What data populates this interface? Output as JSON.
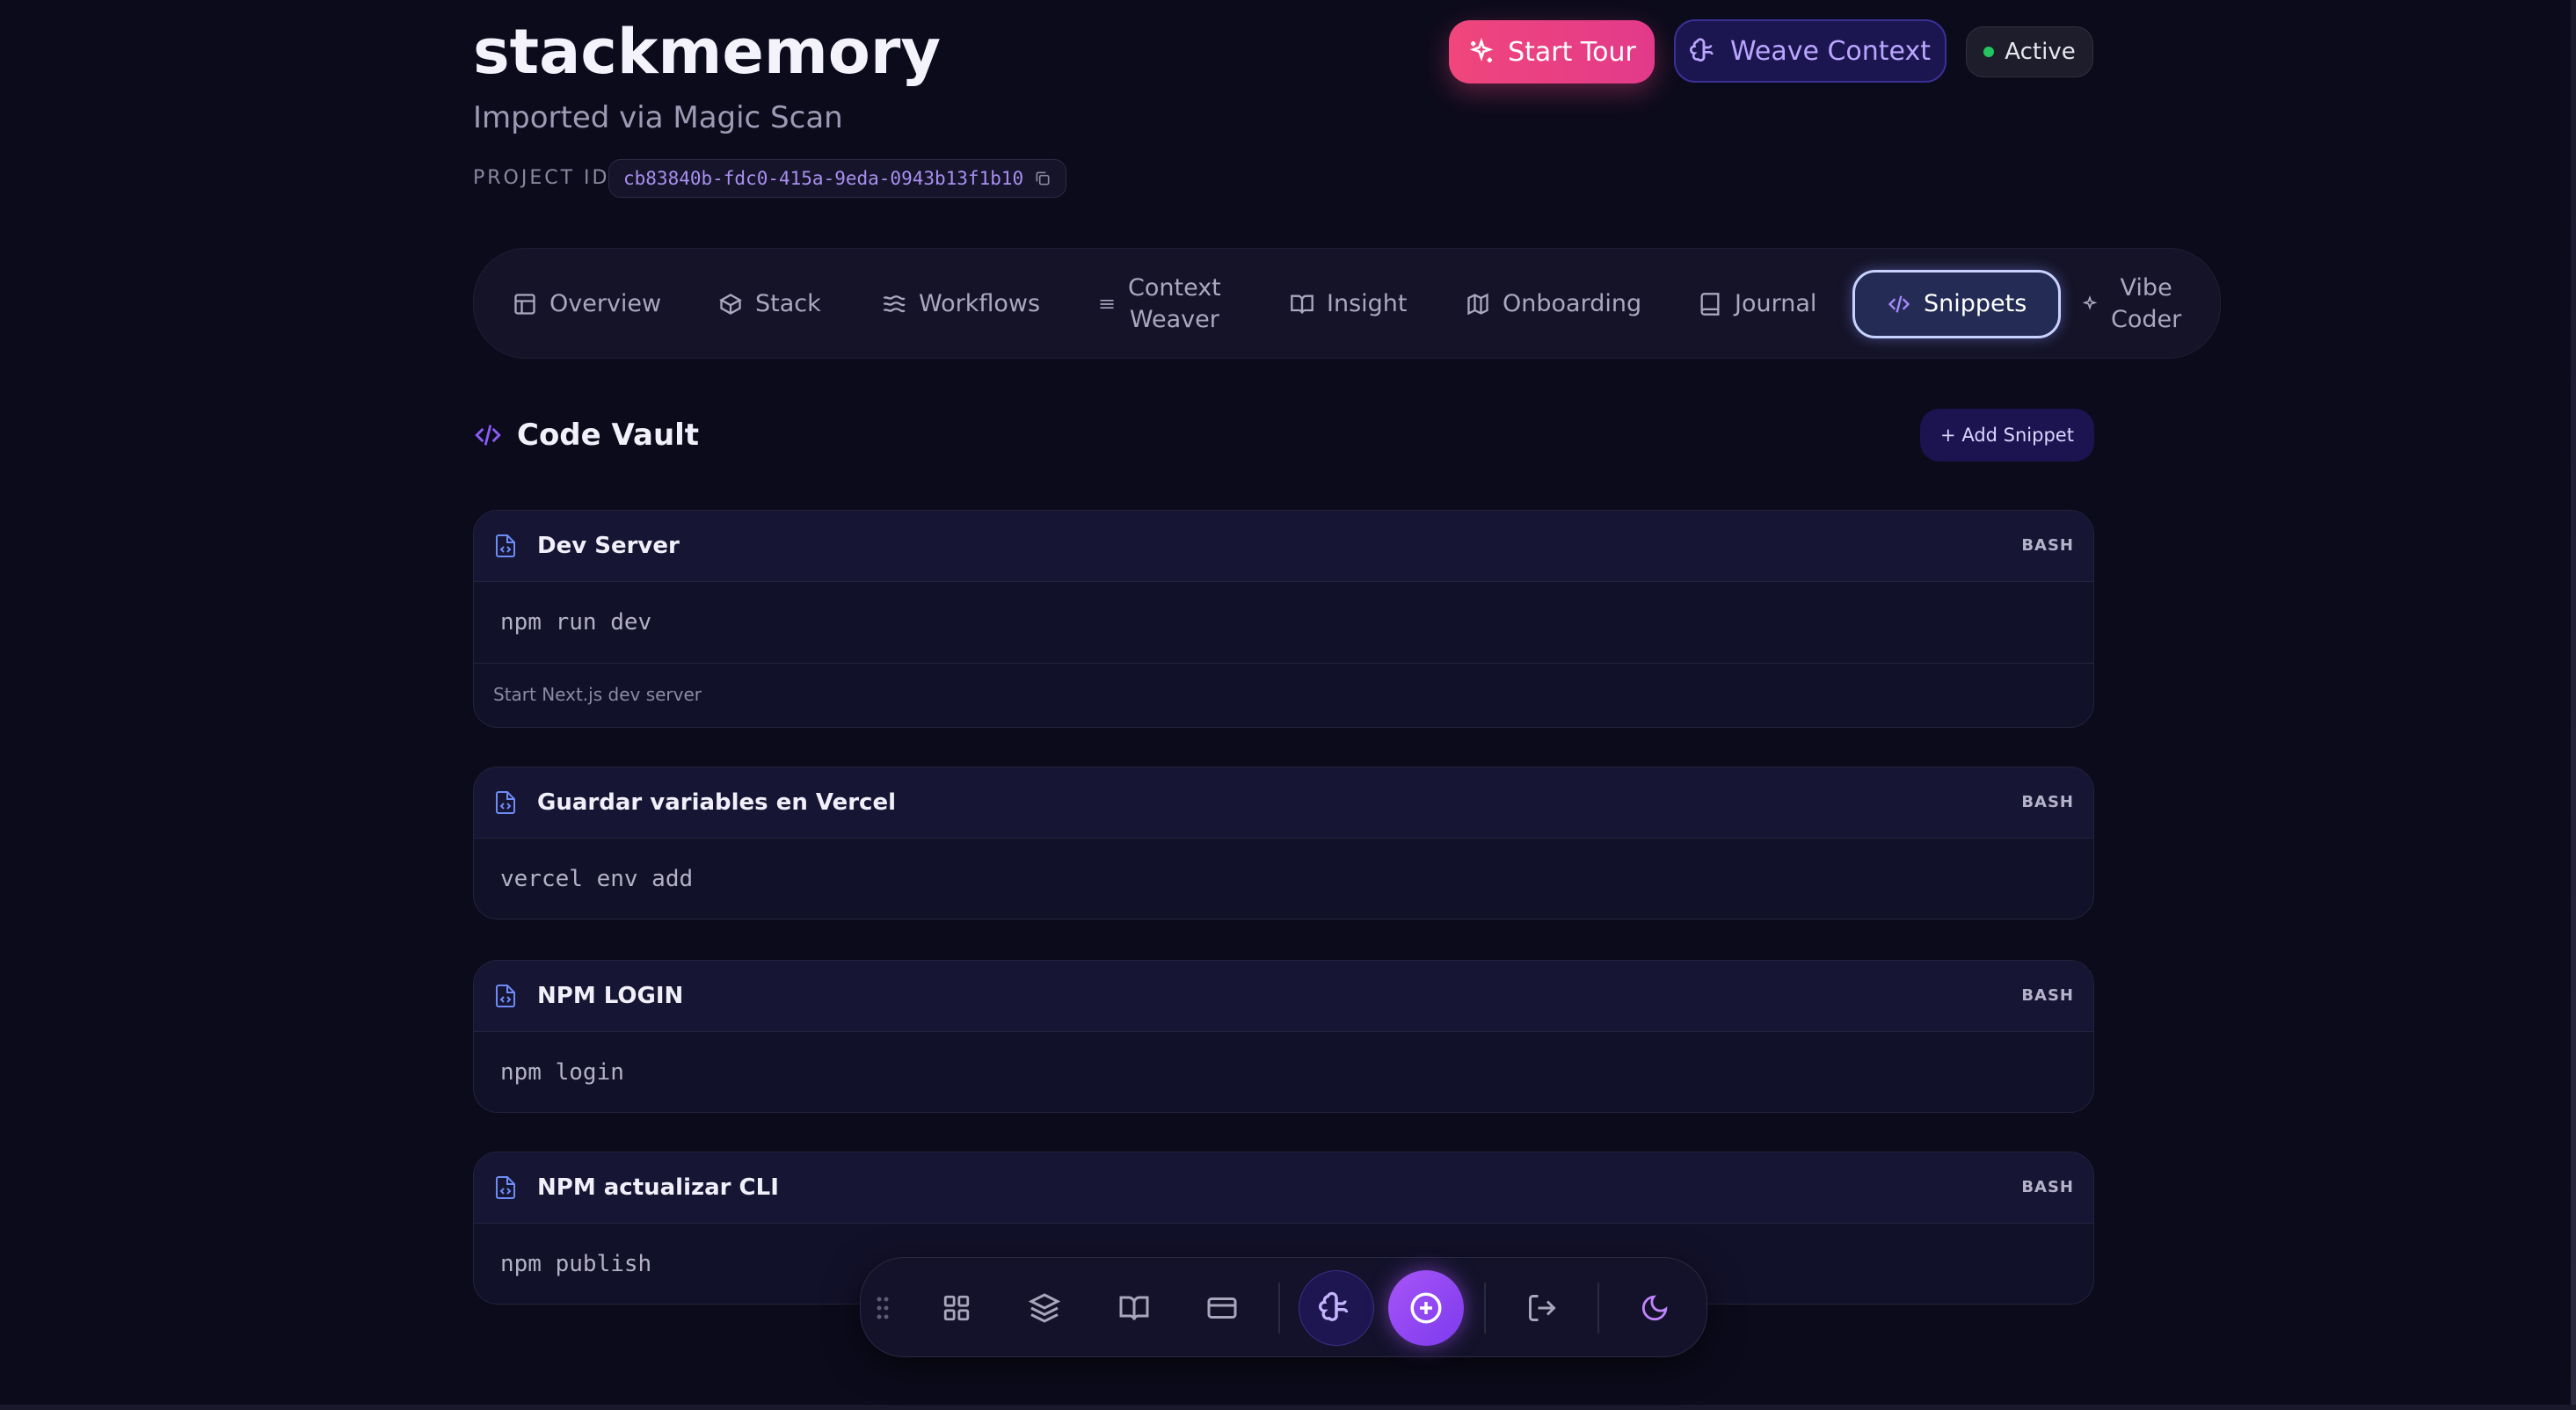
{
  "project": {
    "name": "stackmemory",
    "subtitle": "Imported via Magic Scan",
    "id_label": "PROJECT ID:",
    "id": "cb83840b-fdc0-415a-9eda-0943b13f1b10"
  },
  "header": {
    "tour_label": "Start Tour",
    "weave_label": "Weave Context",
    "status_label": "Active",
    "status_color": "#22c55e"
  },
  "tabs": [
    {
      "label": "Overview",
      "icon": "layout-icon"
    },
    {
      "label": "Stack",
      "icon": "box-icon"
    },
    {
      "label": "Workflows",
      "icon": "waves-icon"
    },
    {
      "label": "Context\nWeaver",
      "icon": "lines-icon"
    },
    {
      "label": "Insight",
      "icon": "book-open-icon"
    },
    {
      "label": "Onboarding",
      "icon": "map-icon"
    },
    {
      "label": "Journal",
      "icon": "book-icon"
    },
    {
      "label": "Snippets",
      "icon": "code-icon",
      "active": true
    },
    {
      "label": "Vibe\nCoder",
      "icon": "sparkles-icon"
    }
  ],
  "vault": {
    "title": "Code Vault",
    "add_label": "+ Add Snippet"
  },
  "snippets": [
    {
      "title": "Dev Server",
      "lang": "BASH",
      "code": "npm run dev",
      "desc": "Start Next.js dev server"
    },
    {
      "title": "Guardar variables en Vercel",
      "lang": "BASH",
      "code": "vercel env add"
    },
    {
      "title": "NPM LOGIN",
      "lang": "BASH",
      "code": "npm login"
    },
    {
      "title": "NPM actualizar CLI",
      "lang": "BASH",
      "code": "npm publish"
    }
  ],
  "dock": {
    "items": [
      "drag-handle-icon",
      "grid-icon",
      "layers-icon",
      "book-open-icon",
      "card-icon",
      "brain-icon",
      "plus-circle-icon",
      "logout-icon",
      "moon-icon"
    ]
  },
  "colors": {
    "background": "#0c0b1c",
    "accent_pink": "#f0467c",
    "accent_purple": "#a855f7",
    "accent_indigo": "#c7d2fe"
  }
}
